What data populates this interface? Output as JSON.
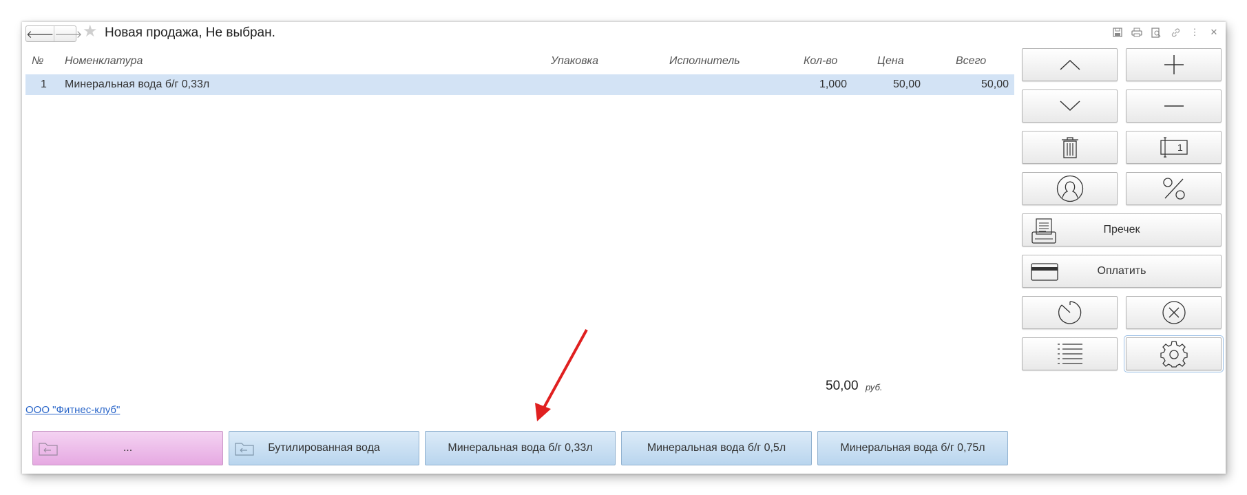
{
  "window": {
    "title": "Новая продажа, Не выбран."
  },
  "table": {
    "columns": {
      "num": "№",
      "item": "Номенклатура",
      "pack": "Упаковка",
      "performer": "Исполнитель",
      "qty": "Кол-во",
      "price": "Цена",
      "total": "Всего"
    },
    "rows": [
      {
        "num": "1",
        "item": "Минеральная вода б/г 0,33л",
        "pack": "",
        "performer": "",
        "qty": "1,000",
        "price": "50,00",
        "total": "50,00"
      }
    ]
  },
  "summary": {
    "total": "50,00",
    "currency": "руб."
  },
  "organization_link": "ООО \"Фитнес-клуб\"",
  "quick_buttons": [
    {
      "label": "..."
    },
    {
      "label": "Бутилированная вода"
    },
    {
      "label": "Минеральная вода б/г 0,33л"
    },
    {
      "label": "Минеральная вода б/г 0,5л"
    },
    {
      "label": "Минеральная вода б/г 0,75л"
    }
  ],
  "right_panel": {
    "precheck_label": "Пречек",
    "pay_label": "Оплатить",
    "quantity_icon_digit": "1"
  },
  "icons": [
    "back-arrow-icon",
    "forward-arrow-icon",
    "star-icon",
    "save-icon",
    "print-icon",
    "preview-icon",
    "link-icon",
    "more-icon",
    "close-icon",
    "arrow-up-icon",
    "plus-icon",
    "arrow-down-icon",
    "minus-icon",
    "trash-icon",
    "quantity-icon",
    "customer-icon",
    "percent-icon",
    "precheck-icon",
    "card-icon",
    "timer-icon",
    "cancel-icon",
    "list-icon",
    "gear-icon",
    "folder-icon"
  ],
  "colors": {
    "row_highlight": "#d3e3f5",
    "quick_button": "#c7ddf2",
    "pink_button": "#eebbe9",
    "link": "#2a66c9",
    "annotation_arrow": "#e02020"
  }
}
